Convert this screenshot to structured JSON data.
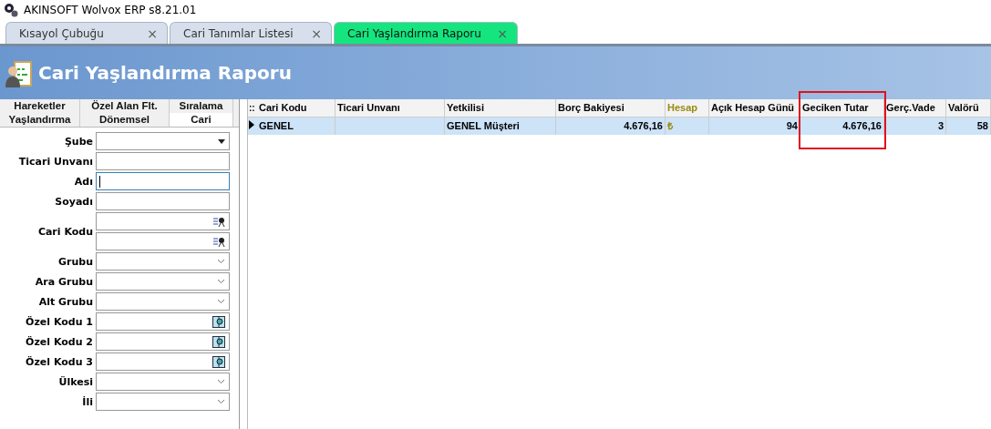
{
  "window": {
    "title": "AKINSOFT Wolvox ERP s8.21.01"
  },
  "tabs": [
    {
      "label": "Kısayol Çubuğu",
      "close": "×",
      "selected": false
    },
    {
      "label": "Cari Tanımlar Listesi",
      "close": "×",
      "selected": false
    },
    {
      "label": "Cari Yaşlandırma Raporu",
      "close": "×",
      "selected": true
    }
  ],
  "header": {
    "title": "Cari Yaşlandırma Raporu"
  },
  "filter_tabs": [
    [
      {
        "label": "Hareketler",
        "selected": false
      },
      {
        "label": "Özel Alan Flt.",
        "selected": false
      },
      {
        "label": "Sıralama",
        "selected": false
      }
    ],
    [
      {
        "label": "Yaşlandırma",
        "selected": false
      },
      {
        "label": "Dönemsel",
        "selected": false
      },
      {
        "label": "Cari",
        "selected": true
      }
    ]
  ],
  "fields": [
    {
      "label": "Şube",
      "kind": "dropdown",
      "focused": false
    },
    {
      "label": "Ticari Unvanı",
      "kind": "text",
      "focused": false
    },
    {
      "label": "Adı",
      "kind": "text",
      "focused": true
    },
    {
      "label": "Soyadı",
      "kind": "text",
      "focused": false
    },
    {
      "label": "Cari Kodu",
      "kind": "range",
      "focused": false
    },
    {
      "label": "Grubu",
      "kind": "select",
      "focused": false
    },
    {
      "label": "Ara Grubu",
      "kind": "select",
      "focused": false
    },
    {
      "label": "Alt Grubu",
      "kind": "select",
      "focused": false
    },
    {
      "label": "Özel Kodu 1",
      "kind": "lookup",
      "focused": false
    },
    {
      "label": "Özel Kodu 2",
      "kind": "lookup",
      "focused": false
    },
    {
      "label": "Özel Kodu 3",
      "kind": "lookup",
      "focused": false
    },
    {
      "label": "Ülkesi",
      "kind": "select",
      "focused": false
    },
    {
      "label": "İli",
      "kind": "select",
      "focused": false
    }
  ],
  "table": {
    "indicator": "::",
    "columns": [
      {
        "label": "Cari Kodu",
        "highlighted": false
      },
      {
        "label": "Ticari Unvanı",
        "highlighted": false
      },
      {
        "label": "Yetkilisi",
        "highlighted": false
      },
      {
        "label": "Borç Bakiyesi",
        "highlighted": false
      },
      {
        "label": "Hesap",
        "highlighted": false
      },
      {
        "label": "Açık Hesap Günü",
        "highlighted": false
      },
      {
        "label": "Geciken Tutar",
        "highlighted": true
      },
      {
        "label": "Gerç.Vade",
        "highlighted": false
      },
      {
        "label": "Valörü",
        "highlighted": false
      }
    ],
    "rows": [
      {
        "selected": true,
        "cells": [
          "GENEL",
          "",
          "GENEL Müşteri",
          "4.676,16",
          "₺",
          "94",
          "4.676,16",
          "3",
          "58"
        ]
      }
    ]
  }
}
